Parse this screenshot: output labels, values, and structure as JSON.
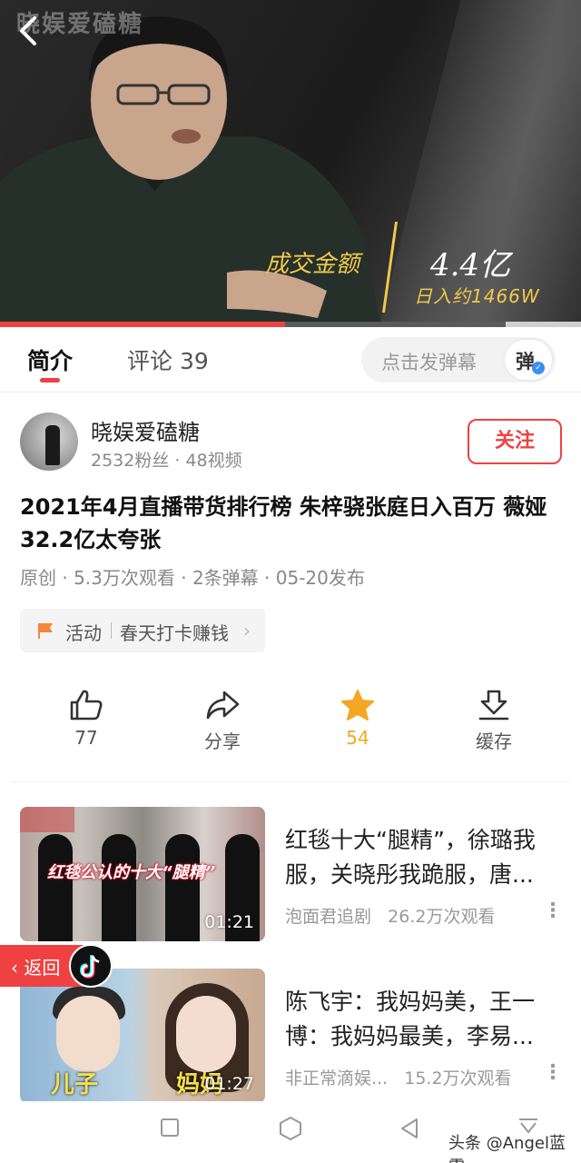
{
  "video": {
    "watermark": "晓娱爱磕糖",
    "deal_label": "成交金额",
    "deal_value": "4.4亿",
    "deal_daily": "日入约1466W",
    "progress_fraction": 0.49,
    "buffer_fraction": 0.87
  },
  "tabs": {
    "intro": "简介",
    "comments": "评论 39",
    "danmu_placeholder": "点击发弹幕",
    "danmu_button": "弹"
  },
  "author": {
    "name": "晓娱爱磕糖",
    "stats": "2532粉丝 · 48视频",
    "follow": "关注"
  },
  "article": {
    "title": "2021年4月直播带货排行榜 朱梓骁张庭日入百万 薇娅32.2亿太夸张",
    "meta": "原创 · 5.3万次观看 · 2条弹幕 · 05-20发布"
  },
  "activity": {
    "label": "活动",
    "text": "春天打卡赚钱"
  },
  "actions": {
    "like_count": "77",
    "share": "分享",
    "favorite_count": "54",
    "cache": "缓存"
  },
  "feed": [
    {
      "title": "红毯十大“腿精”，徐璐我服，关晓彤我跪服，唐...",
      "thumb_caption": "红毯公认的十大“腿精”",
      "duration": "01:21",
      "source": "泡面君追剧",
      "views": "26.2万次观看"
    },
    {
      "title": "陈飞宇：我妈妈美，王一博：我妈妈最美，李易...",
      "thumb_left": "儿子",
      "thumb_right": "妈妈",
      "duration": "01:27",
      "source": "非正常滴娱...",
      "views": "15.2万次观看"
    }
  ],
  "overlay": {
    "return_label": "返回"
  },
  "footer": {
    "source_tag": "头条 @Angel蓝雪"
  },
  "colors": {
    "accent": "#f04142",
    "favorite": "#f5a623",
    "gold": "#f2c94c"
  }
}
